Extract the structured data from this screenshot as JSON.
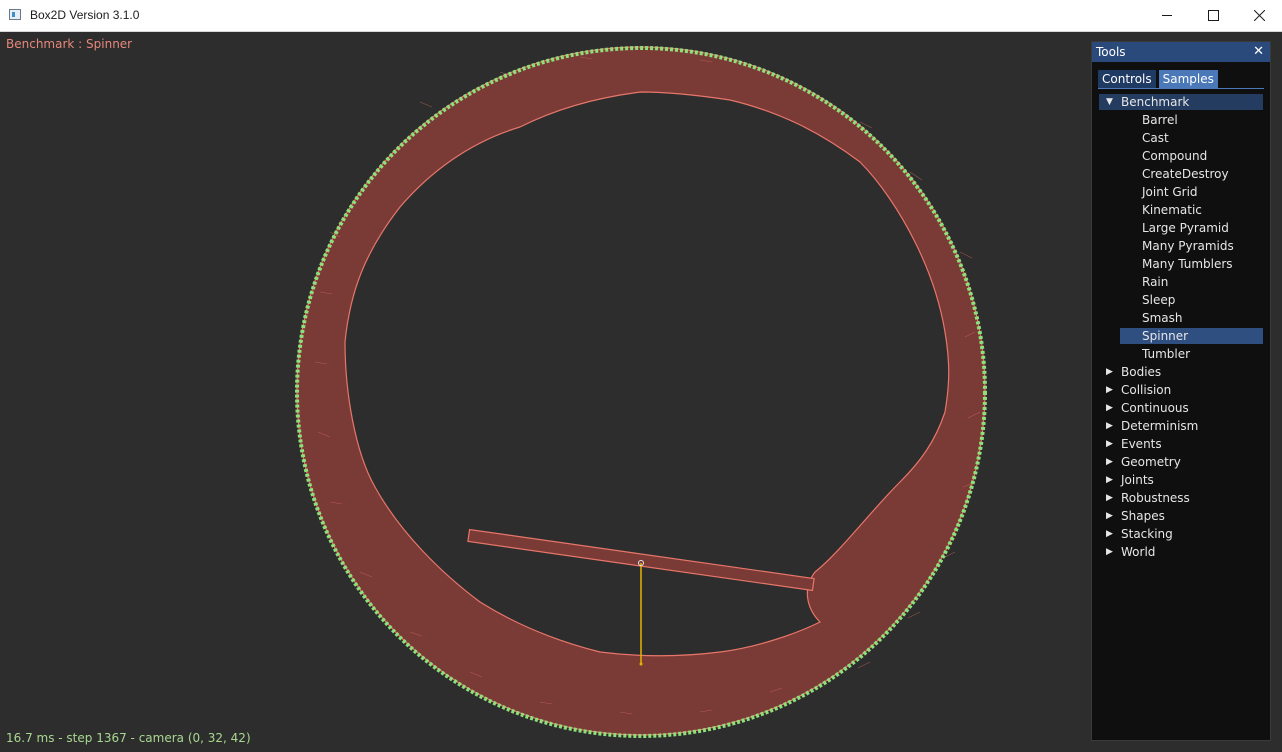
{
  "window": {
    "title": "Box2D Version 3.1.0",
    "buttons": {
      "minimize": "minimize-icon",
      "maximize": "maximize-icon",
      "close": "close-icon"
    }
  },
  "viewport": {
    "sample_title": "Benchmark : Spinner",
    "status": "16.7 ms - step 1367 - camera (0, 32, 42)"
  },
  "colors": {
    "background": "#2d2d2d",
    "boxes_fill": "#7a3a36",
    "boxes_stroke": "#e7766a",
    "boundary": "#8ee07a",
    "spinner_fill": "#7a3a36",
    "spinner_stroke": "#e7766a",
    "joint_line": "#e6b400",
    "panel_header": "#294a7a",
    "panel_bg": "#0f0f0f"
  },
  "tools": {
    "title": "Tools",
    "close_icon": "close-icon",
    "tabs": [
      {
        "label": "Controls",
        "active": false
      },
      {
        "label": "Samples",
        "active": true
      }
    ],
    "tree": [
      {
        "label": "Benchmark",
        "expanded": true,
        "children": [
          "Barrel",
          "Cast",
          "Compound",
          "CreateDestroy",
          "Joint Grid",
          "Kinematic",
          "Large Pyramid",
          "Many Pyramids",
          "Many Tumblers",
          "Rain",
          "Sleep",
          "Smash",
          "Spinner",
          "Tumbler"
        ],
        "selected_child": "Spinner"
      },
      {
        "label": "Bodies",
        "expanded": false
      },
      {
        "label": "Collision",
        "expanded": false
      },
      {
        "label": "Continuous",
        "expanded": false
      },
      {
        "label": "Determinism",
        "expanded": false
      },
      {
        "label": "Events",
        "expanded": false
      },
      {
        "label": "Geometry",
        "expanded": false
      },
      {
        "label": "Joints",
        "expanded": false
      },
      {
        "label": "Robustness",
        "expanded": false
      },
      {
        "label": "Shapes",
        "expanded": false
      },
      {
        "label": "Stacking",
        "expanded": false
      },
      {
        "label": "World",
        "expanded": false
      }
    ]
  }
}
